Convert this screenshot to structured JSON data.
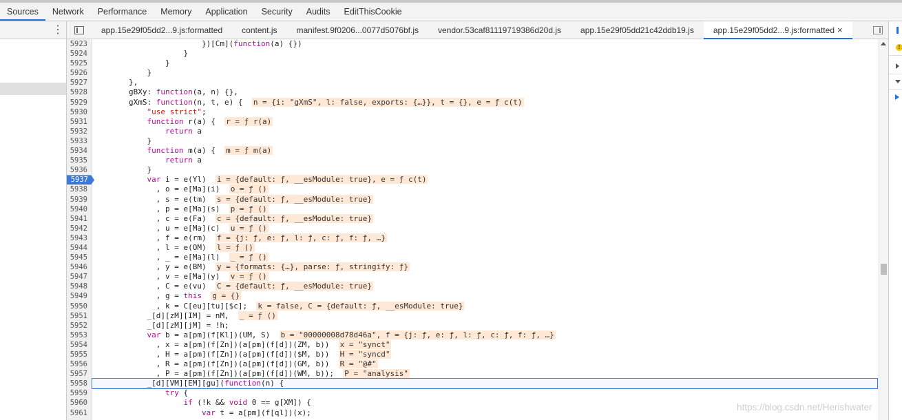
{
  "main_tabs": [
    {
      "label": "Sources",
      "active": true
    },
    {
      "label": "Network"
    },
    {
      "label": "Performance"
    },
    {
      "label": "Memory"
    },
    {
      "label": "Application"
    },
    {
      "label": "Security"
    },
    {
      "label": "Audits"
    },
    {
      "label": "EditThisCookie"
    }
  ],
  "left_panel": {
    "more_icon": "more-vertical-icon"
  },
  "file_tabs": [
    {
      "label": "app.15e29f05dd2...9.js:formatted"
    },
    {
      "label": "content.js"
    },
    {
      "label": "manifest.9f0206...0077d5076bf.js"
    },
    {
      "label": "vendor.53caf81119719386d20d.js"
    },
    {
      "label": "app.15e29f05dd21c42ddb19.js"
    },
    {
      "label": "app.15e29f05dd2...9.js:formatted",
      "active": true,
      "close": "×"
    }
  ],
  "editor": {
    "breakpoint_line": "5937",
    "current_line": "5958",
    "lines": [
      {
        "n": "5923",
        "code": "                        })[Cm](function(a) {})"
      },
      {
        "n": "5924",
        "code": "                    }"
      },
      {
        "n": "5925",
        "code": "                }"
      },
      {
        "n": "5926",
        "code": "            }"
      },
      {
        "n": "5927",
        "code": "        },"
      },
      {
        "n": "5928",
        "code": "        gBXy: function(a, n) {},"
      },
      {
        "n": "5929",
        "code": "        gXmS: function(n, t, e) {",
        "inline": "n = {i: \"gXmS\", l: false, exports: {…}}, t = {}, e = ƒ c(t)"
      },
      {
        "n": "5930",
        "code": "            \"use strict\";"
      },
      {
        "n": "5931",
        "code": "            function r(a) {",
        "inline": "r = ƒ r(a)"
      },
      {
        "n": "5932",
        "code": "                return a"
      },
      {
        "n": "5933",
        "code": "            }"
      },
      {
        "n": "5934",
        "code": "            function m(a) {",
        "inline": "m = ƒ m(a)"
      },
      {
        "n": "5935",
        "code": "                return a"
      },
      {
        "n": "5936",
        "code": "            }"
      },
      {
        "n": "5937",
        "code": "            var i = e(Yl)",
        "inline": "i = {default: ƒ, __esModule: true}, e = ƒ c(t)"
      },
      {
        "n": "5938",
        "code": "              , o = e[Ma](i)",
        "inline": "o = ƒ ()"
      },
      {
        "n": "5939",
        "code": "              , s = e(tm)",
        "inline": "s = {default: ƒ, __esModule: true}"
      },
      {
        "n": "5940",
        "code": "              , p = e[Ma](s)",
        "inline": "p = ƒ ()"
      },
      {
        "n": "5941",
        "code": "              , c = e(Fa)",
        "inline": "c = {default: ƒ, __esModule: true}"
      },
      {
        "n": "5942",
        "code": "              , u = e[Ma](c)",
        "inline": "u = ƒ ()"
      },
      {
        "n": "5943",
        "code": "              , f = e(rm)",
        "inline": "f = {j: ƒ, e: ƒ, l: ƒ, c: ƒ, f: ƒ, …}"
      },
      {
        "n": "5944",
        "code": "              , l = e(OM)",
        "inline": "l = ƒ ()"
      },
      {
        "n": "5945",
        "code": "              , _ = e[Ma](l)",
        "inline": "_ = ƒ ()"
      },
      {
        "n": "5946",
        "code": "              , y = e(BM)",
        "inline": "y = {formats: {…}, parse: ƒ, stringify: ƒ}"
      },
      {
        "n": "5947",
        "code": "              , v = e[Ma](y)",
        "inline": "v = ƒ ()"
      },
      {
        "n": "5948",
        "code": "              , C = e(vu)",
        "inline": "C = {default: ƒ, __esModule: true}"
      },
      {
        "n": "5949",
        "code": "              , g = this",
        "inline": "g = {}"
      },
      {
        "n": "5950",
        "code": "              , k = C[eu][tu][$c];",
        "inline": "k = false, C = {default: ƒ, __esModule: true}"
      },
      {
        "n": "5951",
        "code": "            _[d][zM][IM] = nM,",
        "inline": "_ = ƒ ()"
      },
      {
        "n": "5952",
        "code": "            _[d][zM][jM] = !h;"
      },
      {
        "n": "5953",
        "code": "            var b = a[pm](f[Kl])(UM, S)",
        "inline": "b = \"00000008d78d46a\", f = {j: ƒ, e: ƒ, l: ƒ, c: ƒ, f: ƒ, …}"
      },
      {
        "n": "5954",
        "code": "              , x = a[pm](f[Zn])(a[pm](f[d])(ZM, b))",
        "inline": "x = \"synct\""
      },
      {
        "n": "5955",
        "code": "              , H = a[pm](f[Zn])(a[pm](f[d])($M, b))",
        "inline": "H = \"syncd\""
      },
      {
        "n": "5956",
        "code": "              , R = a[pm](f[Zn])(a[pm](f[d])(GM, b))",
        "inline": "R = \"@#\""
      },
      {
        "n": "5957",
        "code": "              , P = a[pm](f[Zn])(a[pm](f[d])(WM, b));",
        "inline": "P = \"analysis\""
      },
      {
        "n": "5958",
        "code": "            _[d][VM][EM][gu](function(n) {"
      },
      {
        "n": "5959",
        "code": "                try {"
      },
      {
        "n": "5960",
        "code": "                    if (!k && void 0 == g[XM]) {"
      },
      {
        "n": "5961",
        "code": "                        var t = a[pm](f[ql])(x);"
      }
    ]
  },
  "right_panel": {
    "icons": [
      "pause-icon",
      "warning-icon",
      "step-over-icon",
      "step-into-icon",
      "step-out-icon"
    ]
  },
  "watermark": "https://blog.csdn.net/Herishwater"
}
